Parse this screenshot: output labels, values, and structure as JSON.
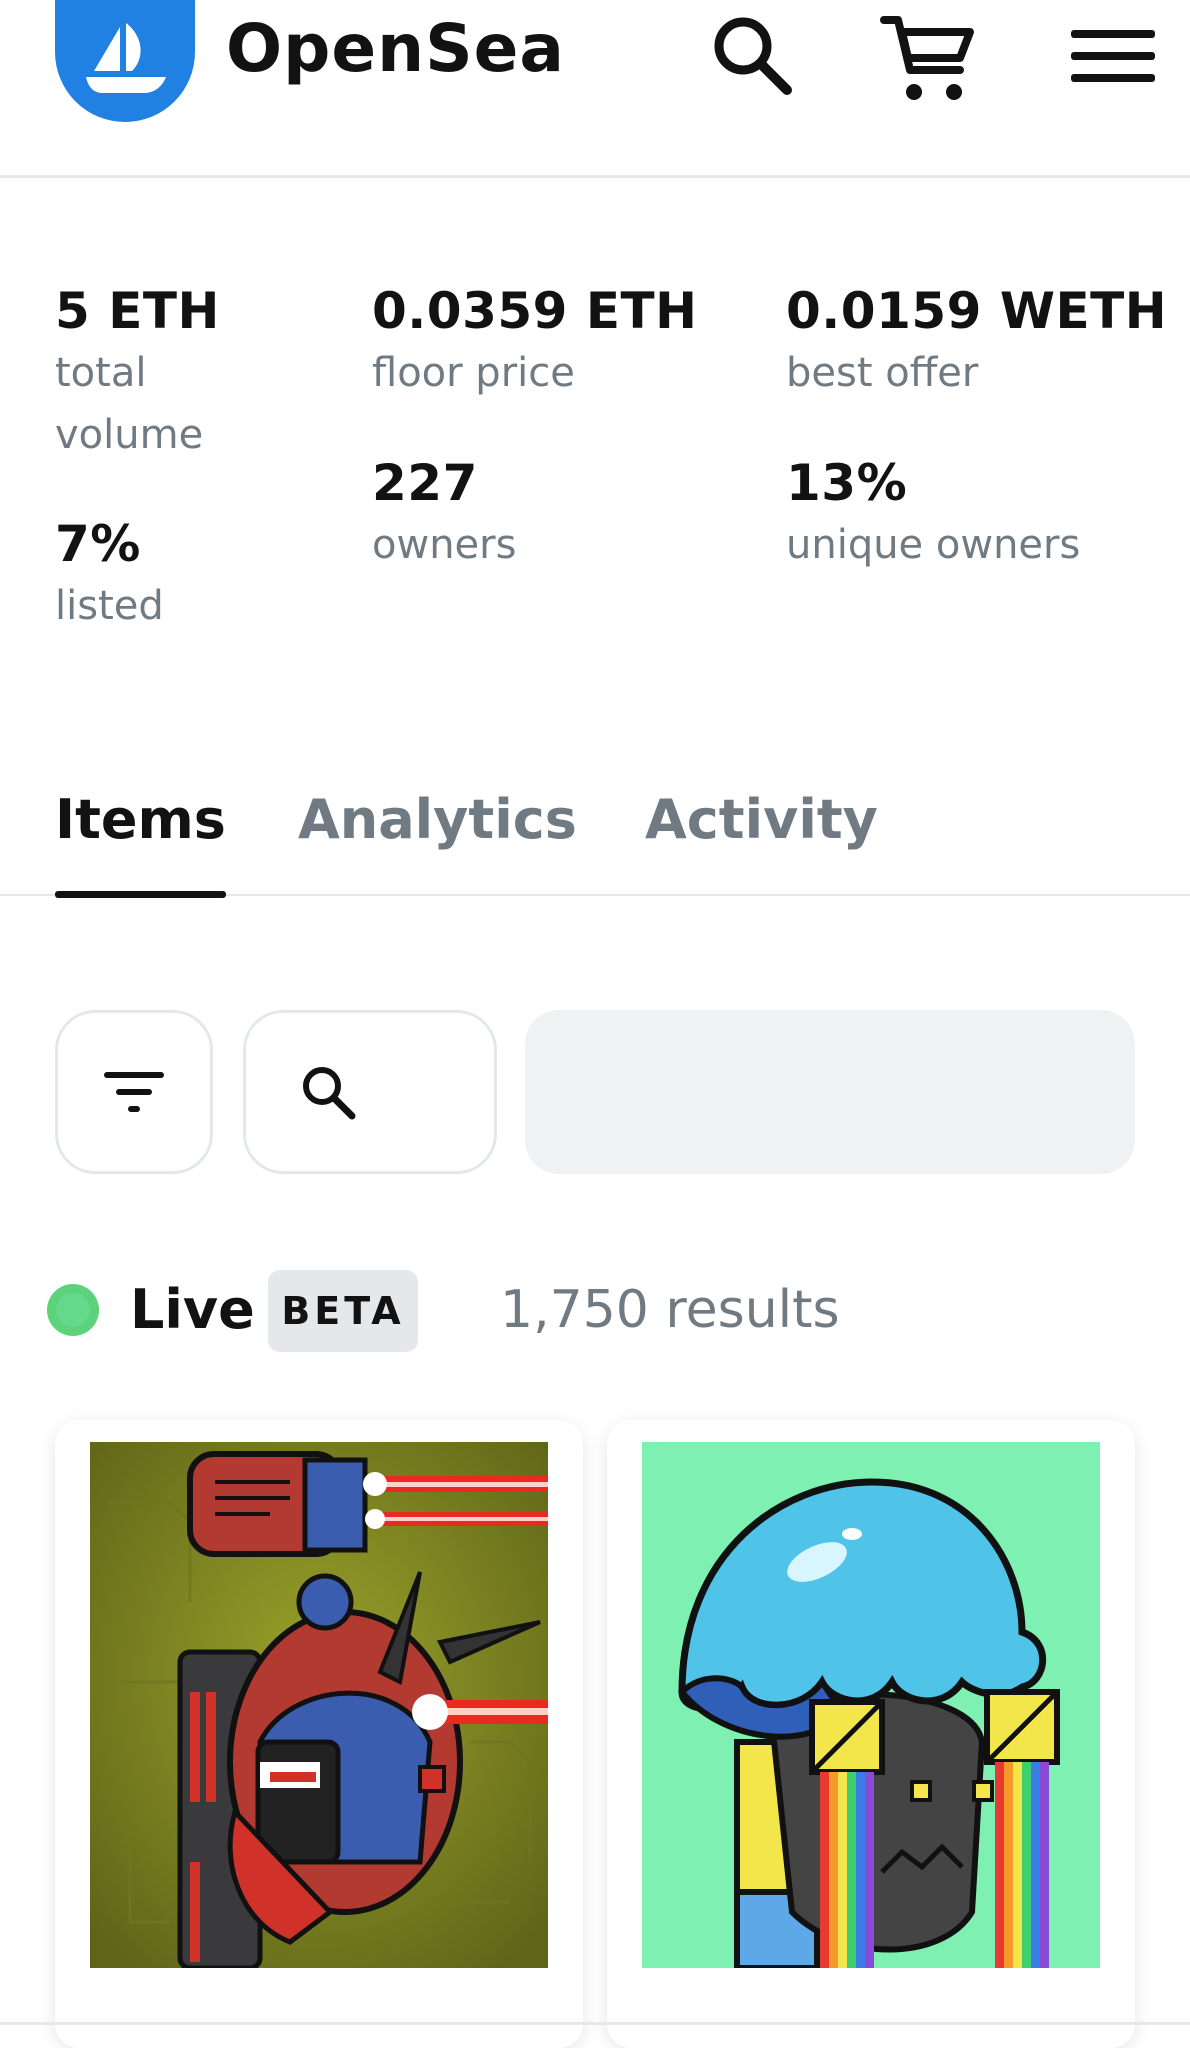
{
  "header": {
    "brand": "OpenSea",
    "icons": [
      "opensea-logo-icon",
      "search-icon",
      "cart-icon",
      "menu-icon"
    ]
  },
  "stats": {
    "total_volume": {
      "value": "5 ETH",
      "label_line1": "total",
      "label_line2": "volume"
    },
    "floor_price": {
      "value": "0.0359 ETH",
      "label": "floor price"
    },
    "best_offer": {
      "value": "0.0159 WETH",
      "label": "best offer"
    },
    "listed": {
      "value": "7%",
      "label": "listed"
    },
    "owners": {
      "value": "227",
      "label": "owners"
    },
    "unique_owners": {
      "value": "13%",
      "label": "unique owners"
    }
  },
  "tabs": [
    {
      "label": "Items",
      "active": true
    },
    {
      "label": "Analytics",
      "active": false
    },
    {
      "label": "Activity",
      "active": false
    }
  ],
  "toolbar": {
    "icons": [
      "filter-icon",
      "search-icon"
    ]
  },
  "status": {
    "live_label": "Live",
    "beta_badge": "BETA",
    "results": "1,750 results"
  },
  "colors": {
    "brand_blue": "#2081e2",
    "live_green": "#3ecf6f",
    "muted_text": "#707a83",
    "card1_bg": "#7a7f1f",
    "card2_bg": "#7ef0b2"
  }
}
